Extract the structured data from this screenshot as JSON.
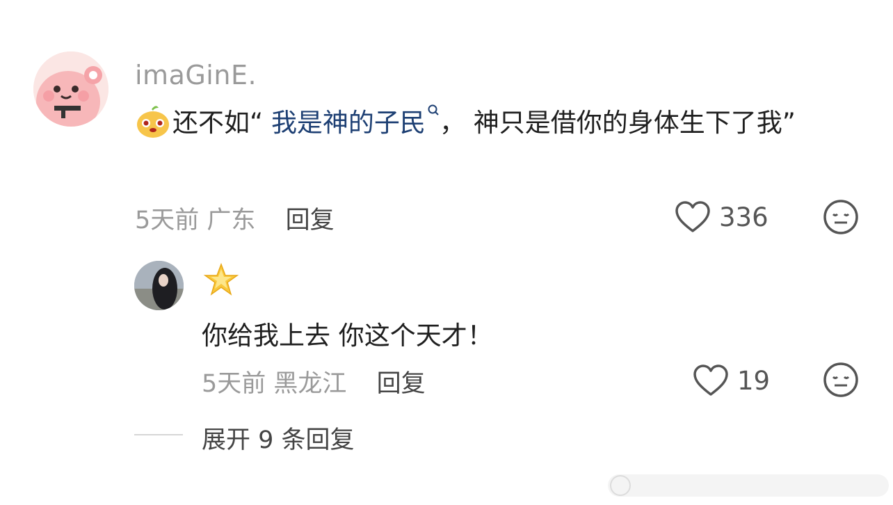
{
  "comment": {
    "username": "imaGinE.",
    "text_prefix": "还不如“ ",
    "link_text": "我是神的子民",
    "text_suffix": "， 神只是借你的身体生下了我”",
    "time": "5天前",
    "location": "广东",
    "reply_label": "回复",
    "likes": "336",
    "avatar_icon": "pink-blob-avatar-icon"
  },
  "reply": {
    "text": "你给我上去 你这个天才！",
    "time": "5天前",
    "location": "黑龙江",
    "reply_label": "回复",
    "likes": "19",
    "name_icon": "star-emoji-icon"
  },
  "expand_label": "展开 9 条回复",
  "colors": {
    "link": "#1d3f73",
    "meta": "#9a9a9a"
  }
}
